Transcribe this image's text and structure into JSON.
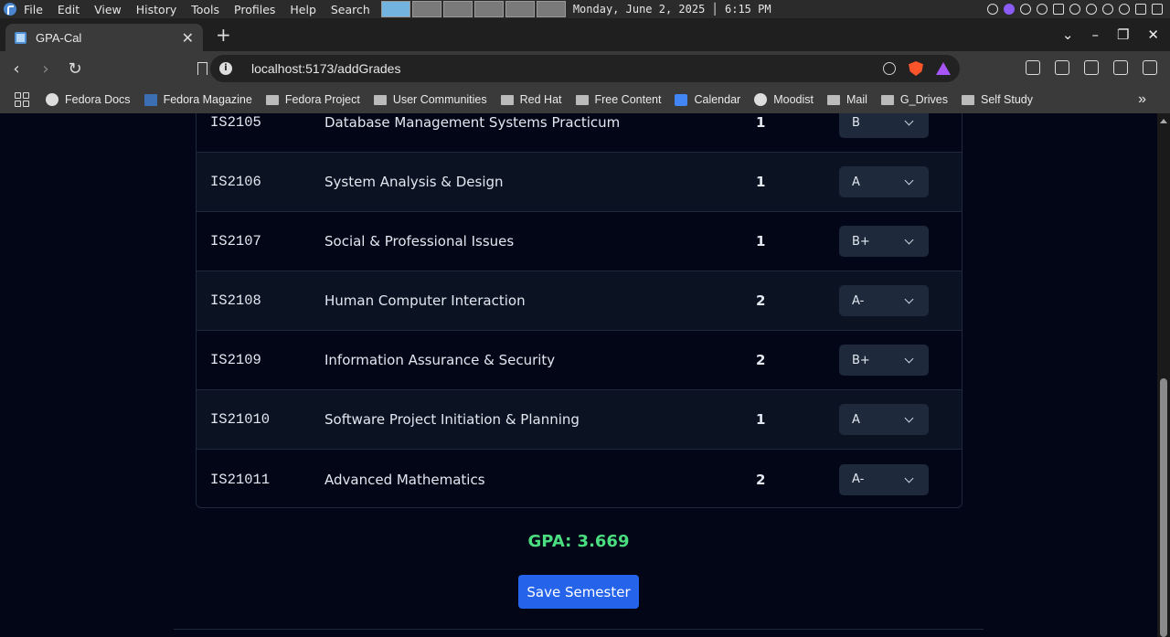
{
  "os": {
    "menu": [
      "File",
      "Edit",
      "View",
      "History",
      "Tools",
      "Profiles",
      "Help",
      "Search"
    ],
    "clock": "Monday, June 2, 2025 │ 6:15 PM"
  },
  "browser": {
    "tab_title": "GPA-Cal",
    "url": "localhost:5173/addGrades",
    "bookmarks": [
      {
        "label": "Fedora Docs",
        "icon": "globe-icon"
      },
      {
        "label": "Fedora Magazine",
        "icon": "fm-icon"
      },
      {
        "label": "Fedora Project",
        "icon": "folder-icon"
      },
      {
        "label": "User Communities",
        "icon": "folder-icon"
      },
      {
        "label": "Red Hat",
        "icon": "folder-icon"
      },
      {
        "label": "Free Content",
        "icon": "folder-icon"
      },
      {
        "label": "Calendar",
        "icon": "calendar-icon"
      },
      {
        "label": "Moodist",
        "icon": "globe-icon"
      },
      {
        "label": "Mail",
        "icon": "folder-icon"
      },
      {
        "label": "G_Drives",
        "icon": "folder-icon"
      },
      {
        "label": "Self Study",
        "icon": "folder-icon"
      }
    ]
  },
  "courses": [
    {
      "code": "IS2105",
      "name": "Database Management Systems Practicum",
      "credits": "1",
      "grade": "B"
    },
    {
      "code": "IS2106",
      "name": "System Analysis & Design",
      "credits": "1",
      "grade": "A"
    },
    {
      "code": "IS2107",
      "name": "Social & Professional Issues",
      "credits": "1",
      "grade": "B+"
    },
    {
      "code": "IS2108",
      "name": "Human Computer Interaction",
      "credits": "2",
      "grade": "A-"
    },
    {
      "code": "IS2109",
      "name": "Information Assurance & Security",
      "credits": "2",
      "grade": "B+"
    },
    {
      "code": "IS21010",
      "name": "Software Project Initiation & Planning",
      "credits": "1",
      "grade": "A"
    },
    {
      "code": "IS21011",
      "name": "Advanced Mathematics",
      "credits": "2",
      "grade": "A-"
    }
  ],
  "gpa_text": "GPA: 3.669",
  "save_label": "Save Semester",
  "colors": {
    "gpa": "#4ade80",
    "button": "#2563eb",
    "background": "#020617"
  }
}
